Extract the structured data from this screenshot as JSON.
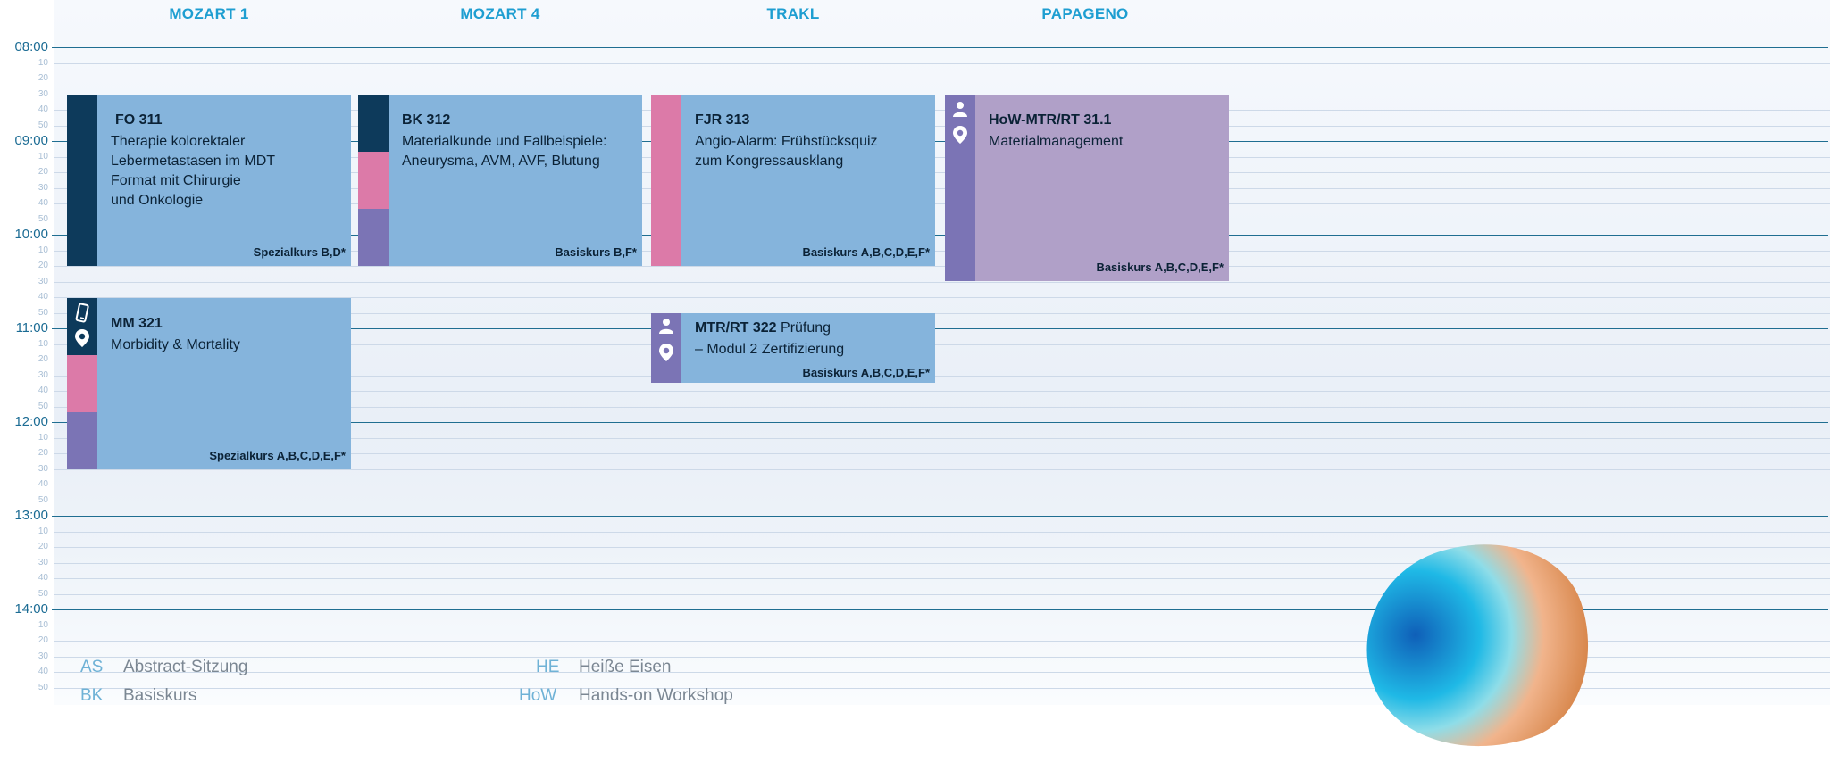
{
  "rooms": [
    "MOZART 1",
    "MOZART 4",
    "TRAKL",
    "PAPAGENO"
  ],
  "time_labels": {
    "hours": [
      "08:00",
      "09:00",
      "10:00",
      "11:00",
      "12:00",
      "13:00",
      "14:00"
    ],
    "minutes": [
      "10",
      "20",
      "30",
      "40",
      "50"
    ]
  },
  "sessions": [
    {
      "code": "FO 311",
      "title_lines": [
        "Therapie kolorektaler",
        "Lebermetastasen im MDT",
        "Format mit Chirurgie",
        "und Onkologie"
      ],
      "course": "Spezialkurs B,D*",
      "body_color": "#85b4dc",
      "strip_colors": [
        "#0d3a5b"
      ]
    },
    {
      "code": "BK 312",
      "title_lines": [
        "Materialkunde und Fallbeispiele:",
        "Aneurysma, AVM, AVF, Blutung"
      ],
      "course": "Basiskurs B,F*",
      "body_color": "#85b4dc",
      "strip_colors": [
        "#0d3a5b",
        "#dc7aa8",
        "#7b74b5"
      ]
    },
    {
      "code": "FJR 313",
      "title_lines": [
        "Angio-Alarm: Frühstücksquiz",
        "zum Kongressausklang"
      ],
      "course": "Basiskurs A,B,C,D,E,F*",
      "body_color": "#85b4dc",
      "strip_colors": [
        "#dc7aa8"
      ]
    },
    {
      "code": "HoW-MTR/RT 31.1",
      "title_lines": [
        "Materialmanagement"
      ],
      "course": "Basiskurs A,B,C,D,E,F*",
      "body_color": "#b0a0c8",
      "strip_colors": [
        "#7b74b5"
      ],
      "icons": [
        "person-icon",
        "location-pin-icon"
      ]
    },
    {
      "code": "MM 321",
      "title_lines": [
        "Morbidity & Mortality"
      ],
      "course": "Spezialkurs A,B,C,D,E,F*",
      "body_color": "#85b4dc",
      "strip_colors": [
        "#0d3a5b",
        "#dc7aa8",
        "#7b74b5"
      ],
      "icons": [
        "mobile-phone-icon",
        "location-pin-icon"
      ]
    },
    {
      "code": "MTR/RT 322",
      "title_inline": "Prüfung",
      "title_lines": [
        "– Modul 2 Zertifizierung"
      ],
      "course": "Basiskurs A,B,C,D,E,F*",
      "body_color": "#85b4dc",
      "strip_colors": [
        "#7b74b5"
      ],
      "icons": [
        "person-icon",
        "location-pin-icon"
      ]
    }
  ],
  "legend": [
    {
      "abbr": "AS",
      "desc": "Abstract-Sitzung"
    },
    {
      "abbr": "BK",
      "desc": "Basiskurs"
    },
    {
      "abbr": "HE",
      "desc": "Heiße Eisen"
    },
    {
      "abbr": "HoW",
      "desc": "Hands-on Workshop"
    }
  ]
}
